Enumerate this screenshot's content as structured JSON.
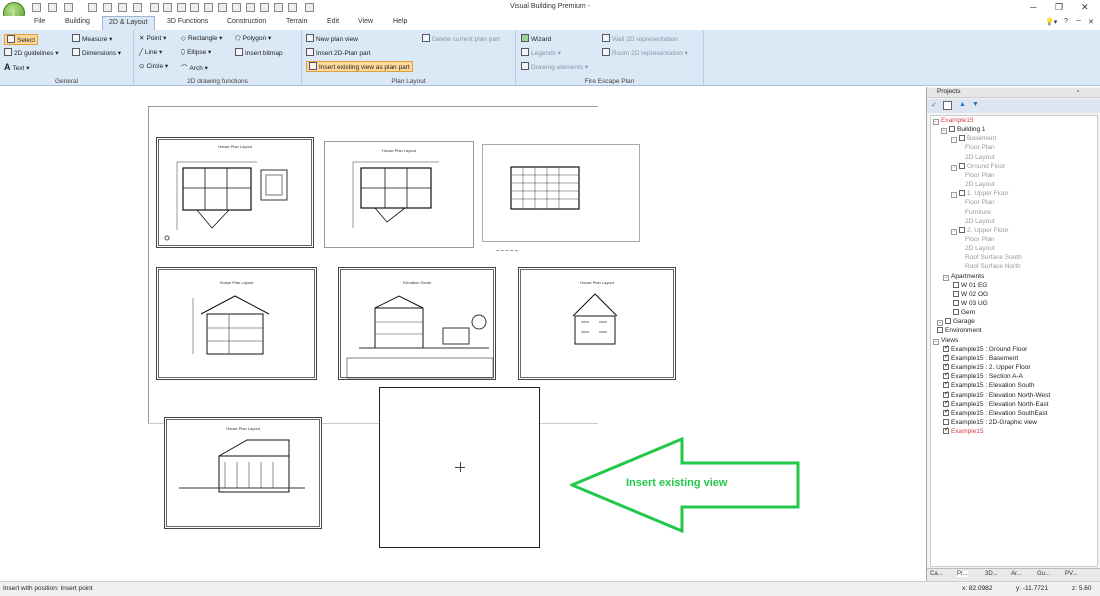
{
  "window": {
    "title": "Visual Building Premium -"
  },
  "tabs": [
    "File",
    "Building",
    "2D & Layout",
    "3D Functions",
    "Construction",
    "Terrain",
    "Edit",
    "View",
    "Help"
  ],
  "ribbon": {
    "general": {
      "label": "General",
      "select": "Select",
      "guidelines": "2D guidelines",
      "text": "Text",
      "measure": "Measure",
      "dimensions": "Dimensions"
    },
    "drawing": {
      "label": "2D drawing functions",
      "point": "Point",
      "line": "Line",
      "circle": "Circle",
      "rectangle": "Rectangle",
      "ellipse": "Ellipse",
      "arch": "Arch",
      "polygon": "Polygon",
      "insert_bitmap": "Insert bitmap"
    },
    "plan": {
      "label": "Plan Layout",
      "new_plan_view": "New plan view",
      "insert_2d_plan_part": "Insert 2D-Plan part",
      "insert_existing_view": "Insert existing view as plan part",
      "delete_plan_part": "Delete current plan part"
    },
    "fire": {
      "label": "Fire Escape Plan",
      "wizard": "Wizard",
      "legends": "Legends",
      "drawing_elements": "Drawing elements",
      "wall_2d": "Wall 2D representation",
      "room_2d": "Room 2D representation"
    }
  },
  "sheets": {
    "s1": "House Plan Layout",
    "s2": "House Plan Layout",
    "s4": "House Plan Layout",
    "s5": "Elevation South",
    "s6": "House Plan Layout",
    "s7": "House Plan Layout"
  },
  "annotation": {
    "text": "Insert existing view",
    "color": "#22c84a"
  },
  "panel": {
    "title": "Projects",
    "tree": [
      {
        "label": "Example15",
        "style": "red"
      },
      {
        "label": "Building 1",
        "style": ""
      },
      {
        "label": "Basement",
        "style": "grey"
      },
      {
        "label": "Floor Plan",
        "style": "grey"
      },
      {
        "label": "2D Layout",
        "style": "grey"
      },
      {
        "label": "Ground Floor",
        "style": "grey"
      },
      {
        "label": "Floor Plan",
        "style": "grey"
      },
      {
        "label": "2D Layout",
        "style": "grey"
      },
      {
        "label": "1. Upper Floor",
        "style": "grey"
      },
      {
        "label": "Floor Plan",
        "style": "grey"
      },
      {
        "label": "Furniture",
        "style": "grey"
      },
      {
        "label": "2D Layout",
        "style": "grey"
      },
      {
        "label": "2. Upper Floor",
        "style": "grey"
      },
      {
        "label": "Floor Plan",
        "style": "grey"
      },
      {
        "label": "2D Layout",
        "style": "grey"
      },
      {
        "label": "Roof Surface South",
        "style": "grey"
      },
      {
        "label": "Roof Surface North",
        "style": "grey"
      },
      {
        "label": "Apartments",
        "style": ""
      },
      {
        "label": "W 01 EG",
        "style": ""
      },
      {
        "label": "W 02 OG",
        "style": ""
      },
      {
        "label": "W 03 UG",
        "style": ""
      },
      {
        "label": "Gem",
        "style": ""
      },
      {
        "label": "Garage",
        "style": ""
      },
      {
        "label": "Environment",
        "style": ""
      },
      {
        "label": "Views",
        "style": ""
      },
      {
        "label": "Example15 : Ground Floor",
        "style": ""
      },
      {
        "label": "Example15 : Basement",
        "style": ""
      },
      {
        "label": "Example15 : 2. Upper Floor",
        "style": ""
      },
      {
        "label": "Example15 : Section A-A",
        "style": ""
      },
      {
        "label": "Example15 : Elevation South",
        "style": ""
      },
      {
        "label": "Example15 : Elevation North-West",
        "style": ""
      },
      {
        "label": "Example15 : Elevation North-East",
        "style": ""
      },
      {
        "label": "Example15 : Elevation SouthEast",
        "style": ""
      },
      {
        "label": "Example15 : 2D-Graphic view",
        "style": ""
      },
      {
        "label": "Example15",
        "style": "red"
      }
    ],
    "bottom_tabs": [
      "Ca...",
      "Pr...",
      "3D...",
      "Ar...",
      "Gu...",
      "PV..."
    ]
  },
  "status": {
    "message": "Insert with position: Insert point",
    "x": "x: 82.0982",
    "y": "y: -11.7721",
    "z": "z: 5.60"
  }
}
